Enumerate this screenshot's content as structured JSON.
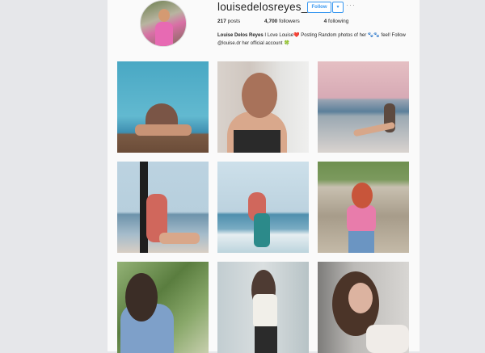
{
  "profile": {
    "username": "louisedelosreyes_",
    "follow_label": "Follow",
    "dropdown_label": "▾",
    "more_label": "···",
    "stats": {
      "posts_count": "217",
      "posts_label": "posts",
      "followers_count": "4,700",
      "followers_label": "followers",
      "following_count": "4",
      "following_label": "following"
    },
    "bio": {
      "name": "Louise Delos Reyes",
      "text": " I Love Louise❤️ Posting Random photos of her 🐾🐾 feel! Follow @louise.dr her official account 🍀"
    }
  },
  "grid": {
    "posts": [
      {
        "icon": "photo-pool"
      },
      {
        "icon": "photo-laughing"
      },
      {
        "icon": "photo-beach-sitting"
      },
      {
        "icon": "photo-seaside-redhair"
      },
      {
        "icon": "photo-waves"
      },
      {
        "icon": "photo-fence-flower"
      },
      {
        "icon": "photo-denim-jacket"
      },
      {
        "icon": "photo-street"
      },
      {
        "icon": "photo-smiling-closeup"
      }
    ]
  },
  "colors": {
    "accent": "#3897f0",
    "page_background": "#fafafa",
    "outer_background": "#e6e7ea"
  }
}
